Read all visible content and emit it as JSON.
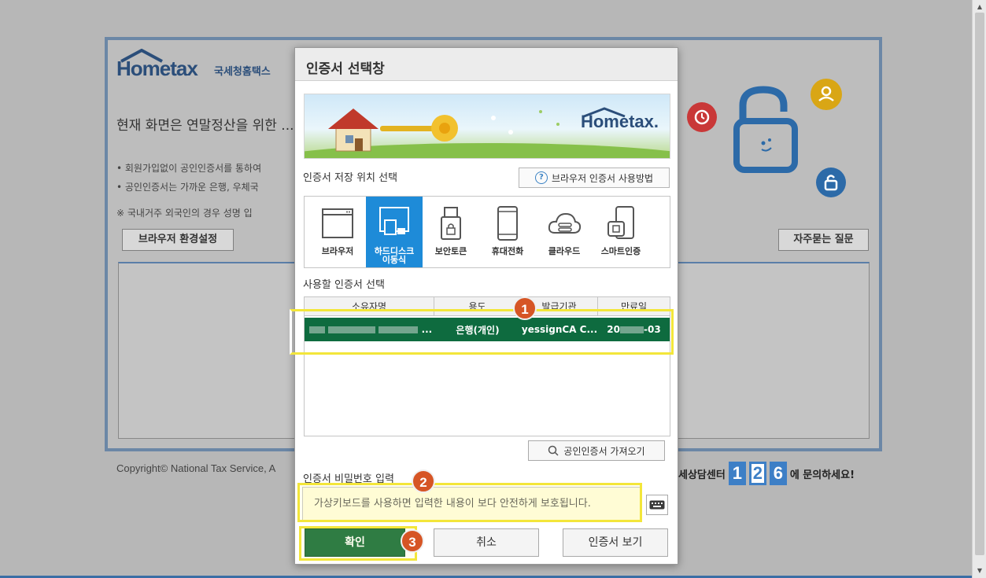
{
  "background": {
    "logo_main": "Hometax",
    "logo_sub": "국세청홈택스",
    "headline": "현재 화면은 연말정산을 위한 ...",
    "bullets": [
      "• 회원가입없이 공인인증서를 통하여",
      "• 공인인증서는 가까운 은행, 우체국",
      "※ 국내거주 외국인의 경우 성명 입"
    ],
    "browser_settings_button": "브라우저 환경설정",
    "faq_button": "자주묻는 질문",
    "copyright": "Copyright© National Tax Service, A",
    "contact_prefix": "세상담센터",
    "contact_digits": [
      "1",
      "2",
      "6"
    ],
    "contact_suffix": "에 문의하세요!"
  },
  "dialog": {
    "title": "인증서 선택창",
    "banner_logo": "Hometax.",
    "storage_label": "인증서 저장 위치 선택",
    "guide_button": "브라우저 인증서 사용방법",
    "storage_options": [
      {
        "label": "브라우저",
        "icon": "browser-icon",
        "active": false
      },
      {
        "label": "하드디스크\n이동식",
        "icon": "usb-drive-icon",
        "active": true
      },
      {
        "label": "보안토큰",
        "icon": "security-token-icon",
        "active": false
      },
      {
        "label": "휴대전화",
        "icon": "mobile-phone-icon",
        "active": false
      },
      {
        "label": "클라우드",
        "icon": "cloud-icon",
        "active": false
      },
      {
        "label": "스마트인증",
        "icon": "smart-auth-icon",
        "active": false
      }
    ],
    "cert_select_label": "사용할 인증서 선택",
    "table": {
      "headers": [
        "소유자명",
        "용도",
        "발급기관",
        "만료일"
      ],
      "rows": [
        {
          "owner": "...",
          "purpose": "은행(개인)",
          "issuer": "yessignCA C...",
          "expiry_prefix": "20",
          "expiry_suffix": "-03"
        }
      ]
    },
    "import_button": "공인인증서 가져오기",
    "password_label": "인증서 비밀번호 입력",
    "password_placeholder": "가상키보드를 사용하면 입력한 내용이 보다 안전하게 보호됩니다.",
    "ok_button": "확인",
    "cancel_button": "취소",
    "view_button": "인증서 보기"
  },
  "annotations": {
    "step1": "1",
    "step2": "2",
    "step3": "3",
    "highlight_color": "#f3e63a",
    "badge_color": "#d65525"
  }
}
